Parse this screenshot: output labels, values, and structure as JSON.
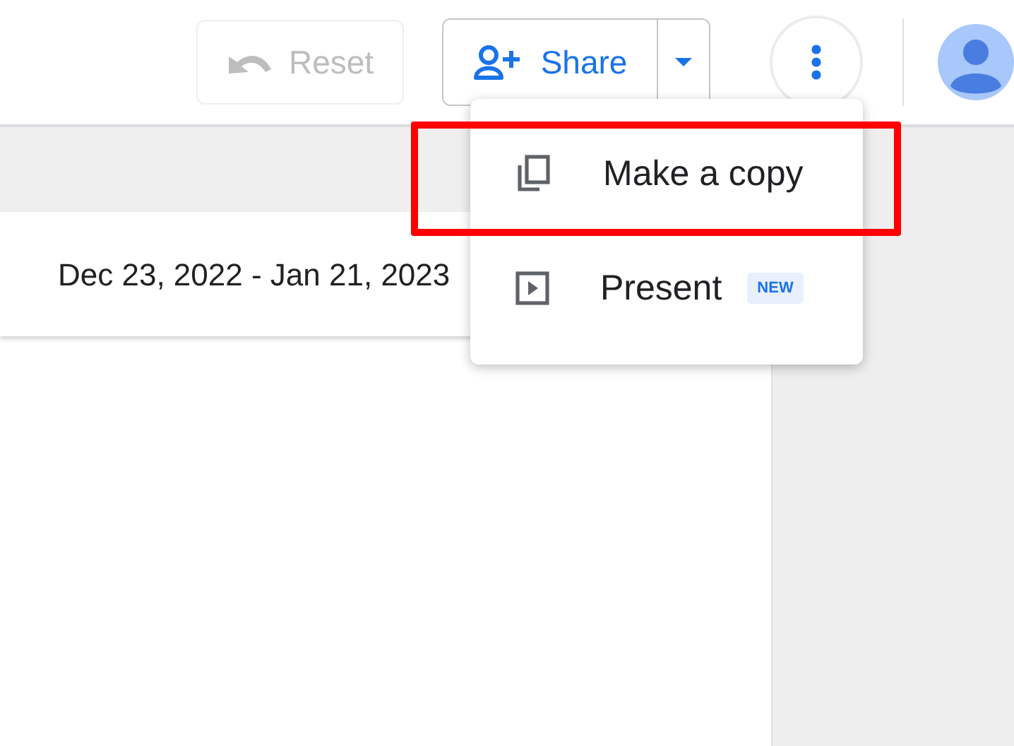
{
  "toolbar": {
    "reset": {
      "label": "Reset",
      "disabled": true
    },
    "share": {
      "label": "Share"
    }
  },
  "date_range": {
    "text": "Dec 23, 2022 - Jan 21, 2023"
  },
  "menu": {
    "items": [
      {
        "kind": "copy",
        "label": "Make a copy",
        "highlighted": true
      },
      {
        "kind": "present",
        "label": "Present",
        "badge": "NEW",
        "highlighted": false
      }
    ]
  }
}
